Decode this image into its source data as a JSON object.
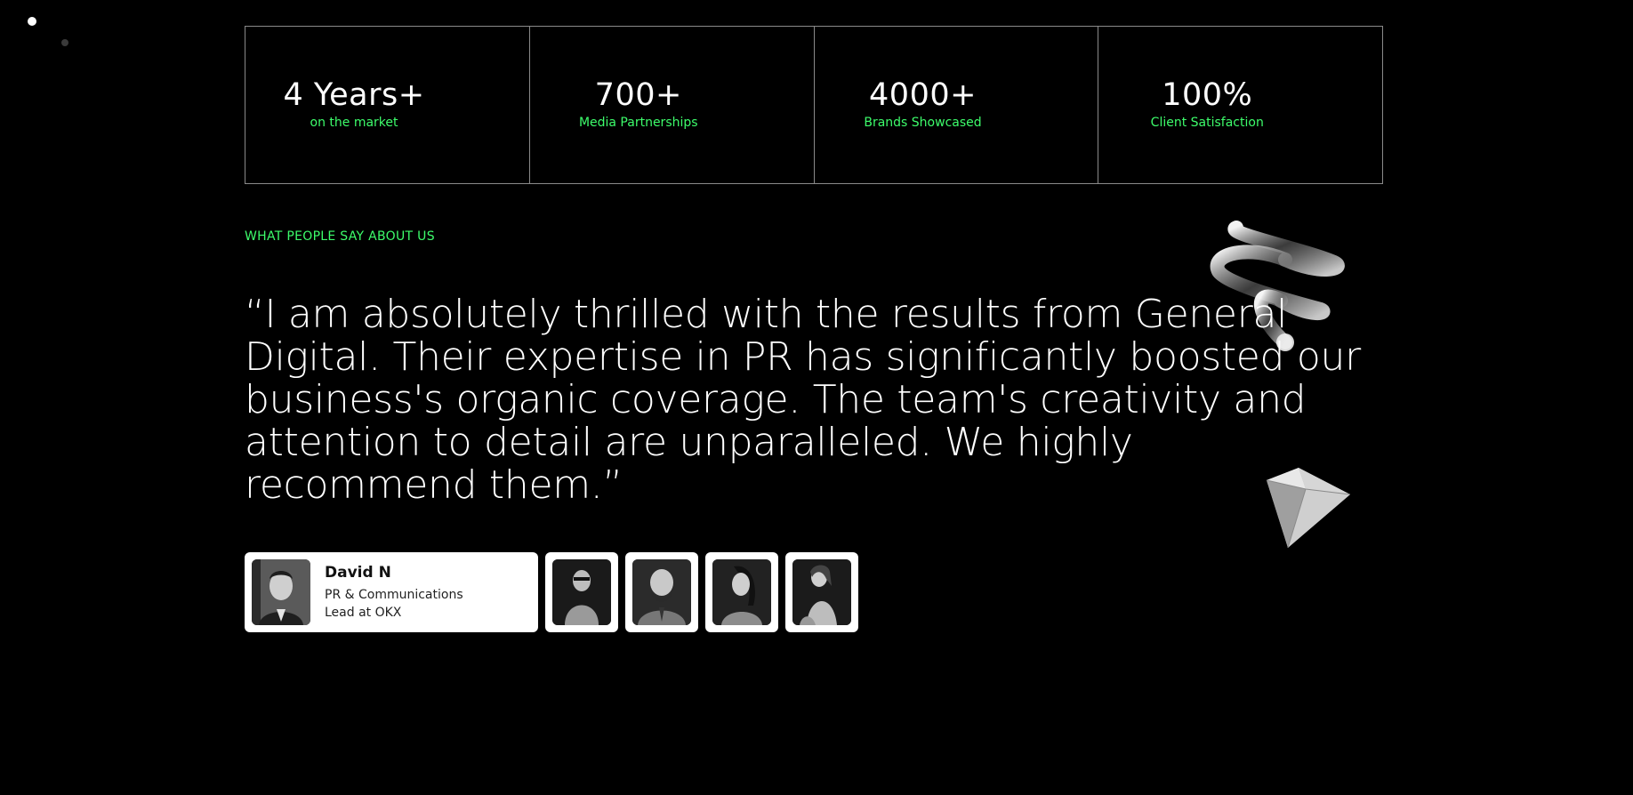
{
  "stats": [
    {
      "value": "4 Years+",
      "label": "on the market"
    },
    {
      "value": "700+",
      "label": "Media Partnerships"
    },
    {
      "value": "4000+",
      "label": "Brands Showcased"
    },
    {
      "value": "100%",
      "label": "Client Satisfaction"
    }
  ],
  "testimonials": {
    "eyebrow": "WHAT PEOPLE SAY ABOUT US",
    "quote": "“I am absolutely thrilled with the results from General Digital. Their expertise in PR has significantly boosted our business's organic coverage. The team's creativity and attention to detail are unparalleled. We highly recommend them.”",
    "active_person": {
      "name": "David N",
      "role": "PR & Communications Lead at OKX"
    }
  },
  "colors": {
    "background": "#000000",
    "accent": "#3dfc6b",
    "border": "#8a8a8a"
  }
}
